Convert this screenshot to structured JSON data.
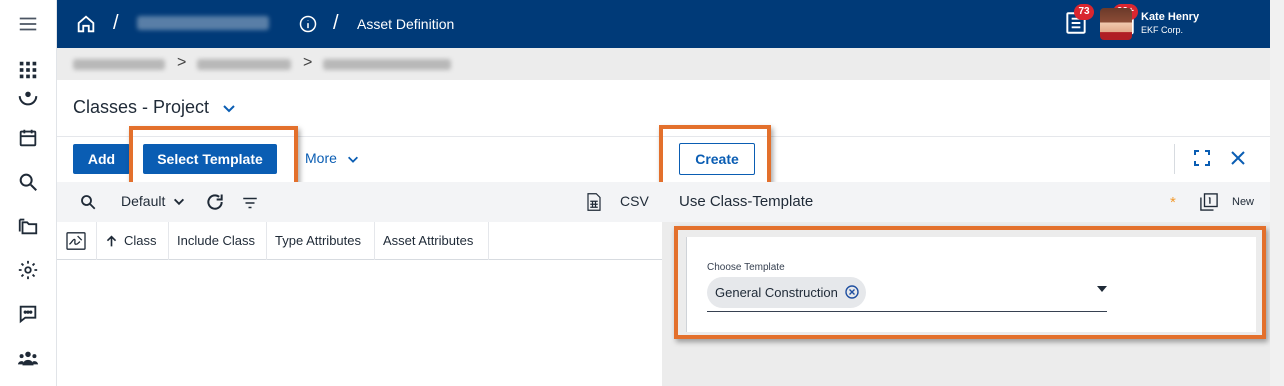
{
  "topbar": {
    "separator": "/",
    "title": "Asset Definition",
    "notifications_count": "73",
    "messages_count": "99+",
    "user_name": "Kate Henry",
    "user_org": "EKF Corp."
  },
  "breadcrumb": {
    "chevron": ">"
  },
  "page": {
    "heading": "Classes - Project"
  },
  "toolbar": {
    "add_label": "Add",
    "select_template_label": "Select Template",
    "more_label": "More",
    "create_label": "Create"
  },
  "grid": {
    "view_label": "Default",
    "csv_label": "CSV",
    "columns": [
      "Class",
      "Include Class",
      "Type Attributes",
      "Asset Attributes"
    ]
  },
  "panel": {
    "title": "Use Class-Template",
    "required_marker": "*",
    "new_label": "New",
    "field_label": "Choose Template",
    "selected_value": "General Construction"
  },
  "colors": {
    "topbar": "#003a78",
    "primary": "#0a5db3",
    "highlight": "#e3702c",
    "badge": "#d9262f"
  },
  "icons": [
    "menu-icon",
    "apps-grid-icon",
    "globe-icon",
    "calendar-icon",
    "search-icon",
    "folders-icon",
    "gear-icon",
    "chat-icon",
    "people-icon",
    "home-icon",
    "info-icon",
    "notes-icon",
    "mail-icon"
  ]
}
